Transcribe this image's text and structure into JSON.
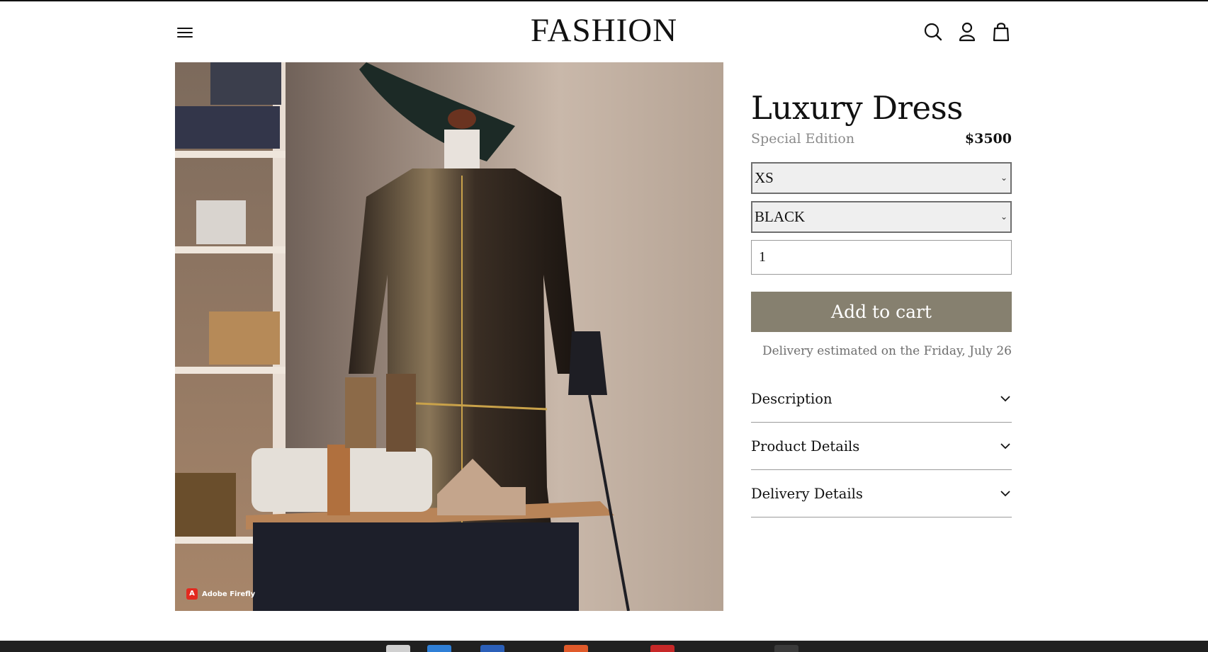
{
  "header": {
    "logo": "FASHION",
    "icons": [
      "menu-icon",
      "search-icon",
      "user-icon",
      "shopping-bag-icon"
    ]
  },
  "hero": {
    "alt": "Luxury Dress",
    "watermark": "Adobe Firefly"
  },
  "product": {
    "title": "Luxury Dress",
    "edition": "Special Edition",
    "price": "$3500",
    "size_select": {
      "value": "XS"
    },
    "color_select": {
      "value": "BLACK"
    },
    "quantity": "1",
    "add_to_cart_label": "Add to cart",
    "delivery_note": "Delivery estimated on the Friday, July 26",
    "accent_color": "#86806f"
  },
  "accordion": [
    {
      "label": "Description"
    },
    {
      "label": "Product Details"
    },
    {
      "label": "Delivery Details"
    }
  ]
}
